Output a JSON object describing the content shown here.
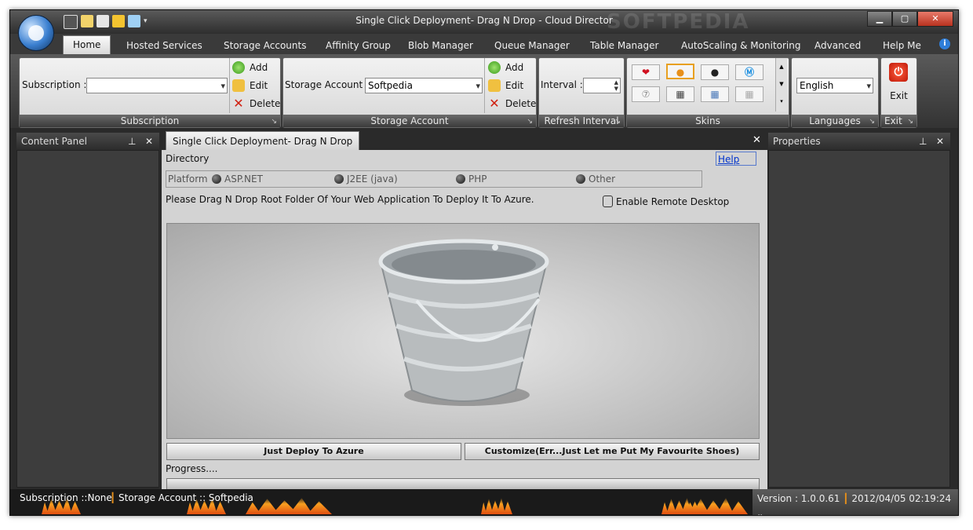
{
  "window": {
    "title": "Single Click Deployment- Drag N Drop - Cloud Director",
    "watermark": "SOFTPEDIA"
  },
  "window_buttons": {
    "minimize": "▁",
    "maximize": "▢",
    "close": "✕"
  },
  "tabs": [
    {
      "label": "Home",
      "active": true
    },
    {
      "label": "Hosted Services"
    },
    {
      "label": "Storage Accounts"
    },
    {
      "label": "Affinity Group"
    },
    {
      "label": "Blob Manager"
    },
    {
      "label": "Queue Manager"
    },
    {
      "label": "Table Manager"
    },
    {
      "label": "AutoScaling & Monitoring"
    },
    {
      "label": "Advanced"
    },
    {
      "label": "Help Me"
    }
  ],
  "ribbon": {
    "subscription": {
      "label": "Subscription :",
      "value": "",
      "add": "Add",
      "edit": "Edit",
      "delete": "Delete",
      "group": "Subscription"
    },
    "storage": {
      "label": "Storage Account :",
      "value": "Softpedia",
      "add": "Add",
      "edit": "Edit",
      "delete": "Delete",
      "group": "Storage Account"
    },
    "interval": {
      "label": "Interval :",
      "value": "",
      "group": "Refresh Interval"
    },
    "skins": {
      "group": "Skins"
    },
    "languages": {
      "value": "English",
      "group": "Languages"
    },
    "exit": {
      "label": "Exit",
      "group": "Exit"
    }
  },
  "content_panel": {
    "title": "Content Panel"
  },
  "properties_panel": {
    "title": "Properties"
  },
  "panel_buttons": {
    "pin": "⊥",
    "close": "✕"
  },
  "document": {
    "tab": "Single Click Deployment- Drag N Drop",
    "close": "✕",
    "directory": "Directory",
    "help": "Help",
    "platform_label": "Platform",
    "platforms": [
      "ASP.NET",
      "J2EE (java)",
      "PHP",
      "Other"
    ],
    "instruction": "Please Drag N Drop Root Folder Of Your Web Application To Deploy It To Azure.",
    "remote_desktop": "Enable Remote Desktop",
    "deploy_button": "Just Deploy To Azure",
    "customize_button": "Customize(Err...Just Let me Put My  Favourite Shoes)",
    "progress_label": "Progress....",
    "progress": 0
  },
  "status": {
    "subscription": "Subscription ::None",
    "storage": "Storage Account :: Softpedia",
    "version": "Version : 1.0.0.61",
    "datetime": "2012/04/05 02:19:24"
  },
  "colors": {
    "chrome": "#2a2a2a",
    "ribbon_face": "#e4e4e4",
    "accent_orange": "#e8a020",
    "link": "#0033cc"
  },
  "icons": [
    "app-orb-icon",
    "add-icon",
    "edit-icon",
    "delete-icon",
    "exit-power-icon",
    "bucket-image"
  ]
}
